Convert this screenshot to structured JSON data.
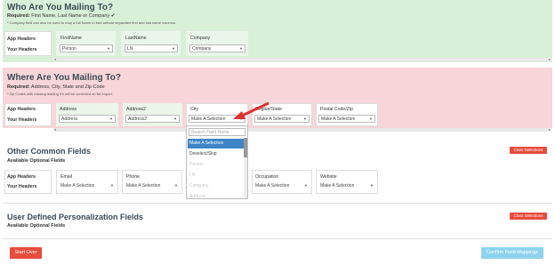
{
  "section_mailing_to": {
    "title": "Who Are You Mailing To?",
    "required_label": "Required:",
    "required_text": "First Name, Last Name or Company",
    "check": "✔",
    "note": "* Company field can also be used to map a full Name in lists without separated first and last name columns.",
    "row_app": "App Headers",
    "row_your": "Your Headers",
    "columns": [
      {
        "header": "FirstName",
        "value": "Person"
      },
      {
        "header": "LastName",
        "value": "LN"
      },
      {
        "header": "Company",
        "value": "Company"
      }
    ]
  },
  "section_address": {
    "title": "Where Are You Mailing To?",
    "required_label": "Required:",
    "required_text": "Address, City, State and Zip Code",
    "note": "* Zip Codes with missing leading 0's will be corrected on list import.",
    "row_app": "App Headers",
    "row_your": "Your Headers",
    "columns": [
      {
        "header": "Address",
        "value": "Address"
      },
      {
        "header": "Address2",
        "value": "Address2"
      },
      {
        "header": "City",
        "value": "Make A Selection"
      },
      {
        "header": "Region/State",
        "value": "Make A Selection"
      },
      {
        "header": "Postal Code/Zip",
        "value": "Make A Selection"
      }
    ]
  },
  "dropdown": {
    "search_placeholder": "Search Field Name",
    "options": [
      "Make A Selection",
      "Deselect/Skip",
      "Person",
      "LN",
      "Company",
      "Address"
    ]
  },
  "section_other": {
    "title": "Other Common Fields",
    "subtitle": "Available Optional Fields",
    "clear_label": "Clear Selections",
    "row_app": "App Headers",
    "row_your": "Your Headers",
    "columns": [
      {
        "header": "Email",
        "value": "Make A Selection"
      },
      {
        "header": "Phone",
        "value": "Make A Selection"
      },
      {
        "header": "Occupation",
        "value": "Make A Selection"
      },
      {
        "header": "Website",
        "value": "Make A Selection"
      }
    ]
  },
  "section_user": {
    "title": "User Defined Personalization Fields",
    "subtitle": "Available Optional Fields",
    "clear_label": "Clear Selections"
  },
  "footer": {
    "start_over": "Start Over",
    "confirm": "Confirm Field Mappings"
  },
  "colors": {
    "green_panel": "#d9f0d8",
    "pink_panel": "#f7d5d8",
    "red_button": "#e74c3c",
    "confirm_button": "#8dd3ee",
    "arrow": "#e03030"
  }
}
